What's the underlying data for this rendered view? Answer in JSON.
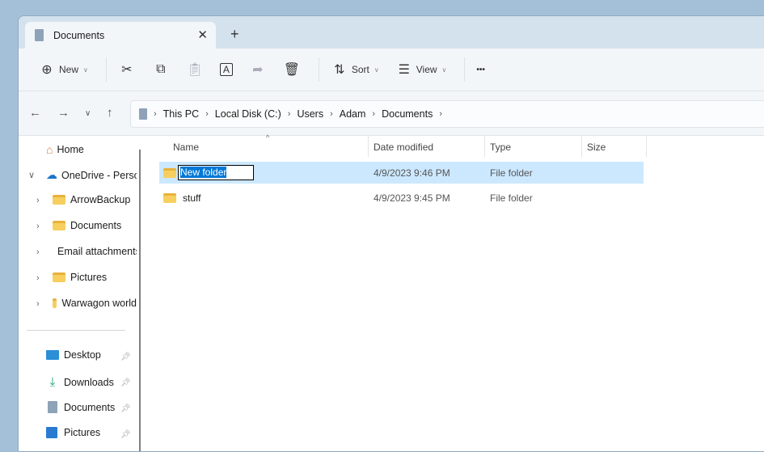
{
  "tab": {
    "title": "Documents",
    "close": "✕",
    "new_tab": "+"
  },
  "toolbar": {
    "new": "New",
    "sort": "Sort",
    "view": "View",
    "more": "•••"
  },
  "address": {
    "crumbs": [
      "This PC",
      "Local Disk (C:)",
      "Users",
      "Adam",
      "Documents"
    ]
  },
  "sidebar": {
    "home": "Home",
    "onedrive": "OneDrive - Personal",
    "onedrive_items": [
      "ArrowBackup",
      "Documents",
      "Email attachments",
      "Pictures",
      "Warwagon world"
    ],
    "quick": [
      "Desktop",
      "Downloads",
      "Documents",
      "Pictures"
    ]
  },
  "columns": {
    "name": "Name",
    "date": "Date modified",
    "type": "Type",
    "size": "Size"
  },
  "files": [
    {
      "name": "New folder",
      "date": "4/9/2023 9:46 PM",
      "type": "File folder",
      "size": ""
    },
    {
      "name": "stuff",
      "date": "4/9/2023 9:45 PM",
      "type": "File folder",
      "size": ""
    }
  ]
}
